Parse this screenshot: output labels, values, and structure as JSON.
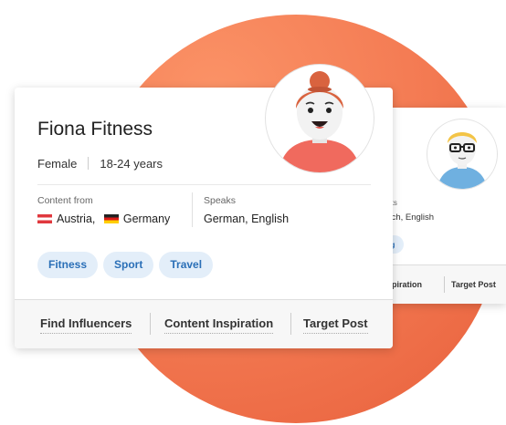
{
  "colors": {
    "accent_circle": "#f47c54",
    "chip_bg": "#e3eef9",
    "chip_text": "#2a6fb7",
    "hair": "#d9633f",
    "shirt_front": "#f06a5e",
    "shirt_back": "#6fb0e0"
  },
  "front_card": {
    "name": "Fiona Fitness",
    "gender": "Female",
    "age": "18-24 years",
    "content_label": "Content from",
    "countries": [
      "Austria,",
      "Germany"
    ],
    "speaks_label": "Speaks",
    "speaks_value": "German, English",
    "tags": [
      "Fitness",
      "Sport",
      "Travel"
    ],
    "actions": [
      "Find Influencers",
      "Content Inspiration",
      "Target Post"
    ],
    "avatar_icon": "female-avatar-icon"
  },
  "back_card": {
    "speaks_label": "eaks",
    "speaks_value": "ench, English",
    "tag": "ng",
    "actions": [
      "Inspiration",
      "Target Post"
    ],
    "avatar_icon": "male-avatar-with-glasses-icon"
  }
}
